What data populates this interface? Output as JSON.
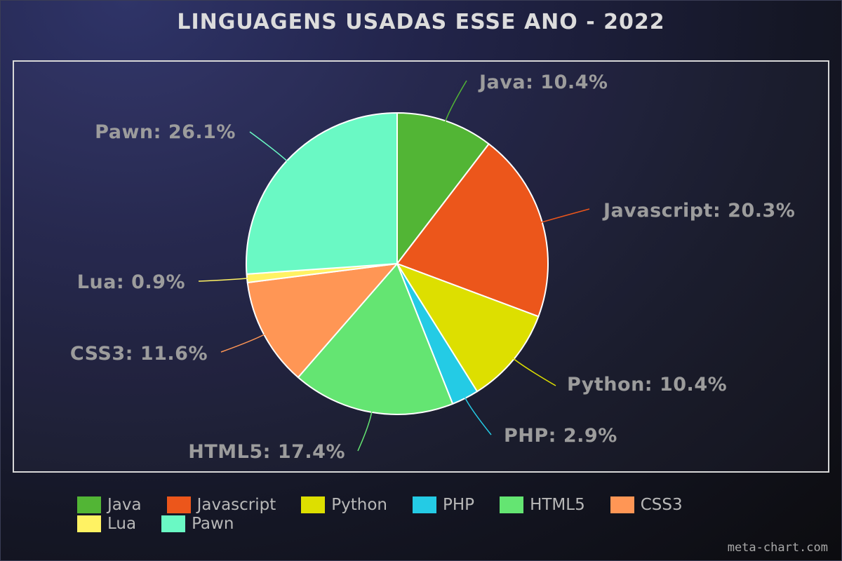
{
  "chart_data": {
    "type": "pie",
    "title": "LINGUAGENS USADAS ESSE ANO - 2022",
    "slices": [
      {
        "label": "Java",
        "value": 10.4,
        "display": "Java: 10.4%",
        "color": "#52b535"
      },
      {
        "label": "Javascript",
        "value": 20.3,
        "display": "Javascript: 20.3%",
        "color": "#ec561b"
      },
      {
        "label": "Python",
        "value": 10.4,
        "display": "Python: 10.4%",
        "color": "#dddf00"
      },
      {
        "label": "PHP",
        "value": 2.9,
        "display": "PHP: 2.9%",
        "color": "#24cbe5"
      },
      {
        "label": "HTML5",
        "value": 17.4,
        "display": "HTML5: 17.4%",
        "color": "#64e572"
      },
      {
        "label": "CSS3",
        "value": 11.6,
        "display": "CSS3: 11.6%",
        "color": "#ff9655"
      },
      {
        "label": "Lua",
        "value": 0.9,
        "display": "Lua: 0.9%",
        "color": "#fff263"
      },
      {
        "label": "Pawn",
        "value": 26.1,
        "display": "Pawn: 26.1%",
        "color": "#6af9c4"
      }
    ],
    "legend": {
      "placement": "bottom"
    }
  },
  "watermark": "meta-chart.com"
}
